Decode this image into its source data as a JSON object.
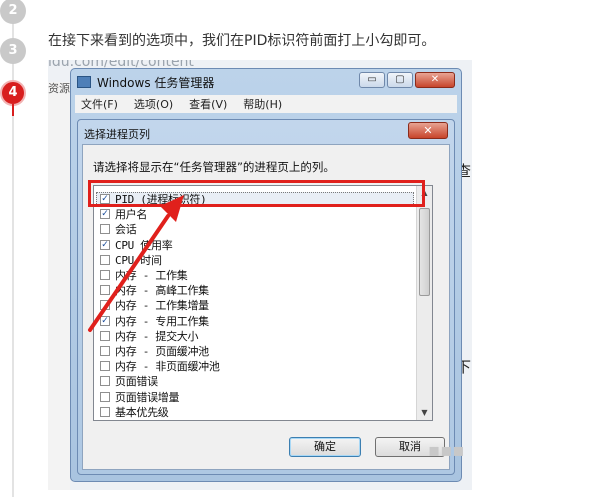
{
  "steps": {
    "numbers": [
      "2",
      "3",
      "4"
    ],
    "active": "4"
  },
  "instruction": "在接下来看到的选项中，我们在PID标识符前面打上小勾即可。",
  "background_page": {
    "url_fragment": "idu.com/edit/content",
    "left_text": "资源",
    "right_chars": [
      "查",
      "下"
    ]
  },
  "task_manager": {
    "title": "Windows 任务管理器",
    "window_controls": [
      "▭",
      "▢"
    ],
    "close_glyph": "✕",
    "menu": [
      "文件(F)",
      "选项(O)",
      "查看(V)",
      "帮助(H)"
    ]
  },
  "dialog": {
    "title": "选择进程页列",
    "close_glyph": "✕",
    "prompt": "请选择将显示在“任务管理器”的进程页上的列。",
    "check_glyph": "✓",
    "columns": [
      {
        "label": "PID (进程标识符)",
        "checked": true,
        "selected": true
      },
      {
        "label": "用户名",
        "checked": true
      },
      {
        "label": "会话",
        "checked": false
      },
      {
        "label": "CPU 使用率",
        "checked": true
      },
      {
        "label": "CPU 时间",
        "checked": false
      },
      {
        "label": "内存 - 工作集",
        "checked": false
      },
      {
        "label": "内存 - 高峰工作集",
        "checked": false
      },
      {
        "label": "内存 - 工作集增量",
        "checked": false
      },
      {
        "label": "内存 - 专用工作集",
        "checked": true
      },
      {
        "label": "内存 - 提交大小",
        "checked": false
      },
      {
        "label": "内存 - 页面缓冲池",
        "checked": false
      },
      {
        "label": "内存 - 非页面缓冲池",
        "checked": false
      },
      {
        "label": "页面错误",
        "checked": false
      },
      {
        "label": "页面错误增量",
        "checked": false
      },
      {
        "label": "基本优先级",
        "checked": false
      }
    ],
    "scroll_up": "▲",
    "scroll_down": "▼",
    "ok_label": "确定",
    "cancel_label": "取消"
  },
  "colors": {
    "accent_red": "#e0201c",
    "step_active": "#d81e1e",
    "step_inactive": "#c9c9c9"
  }
}
